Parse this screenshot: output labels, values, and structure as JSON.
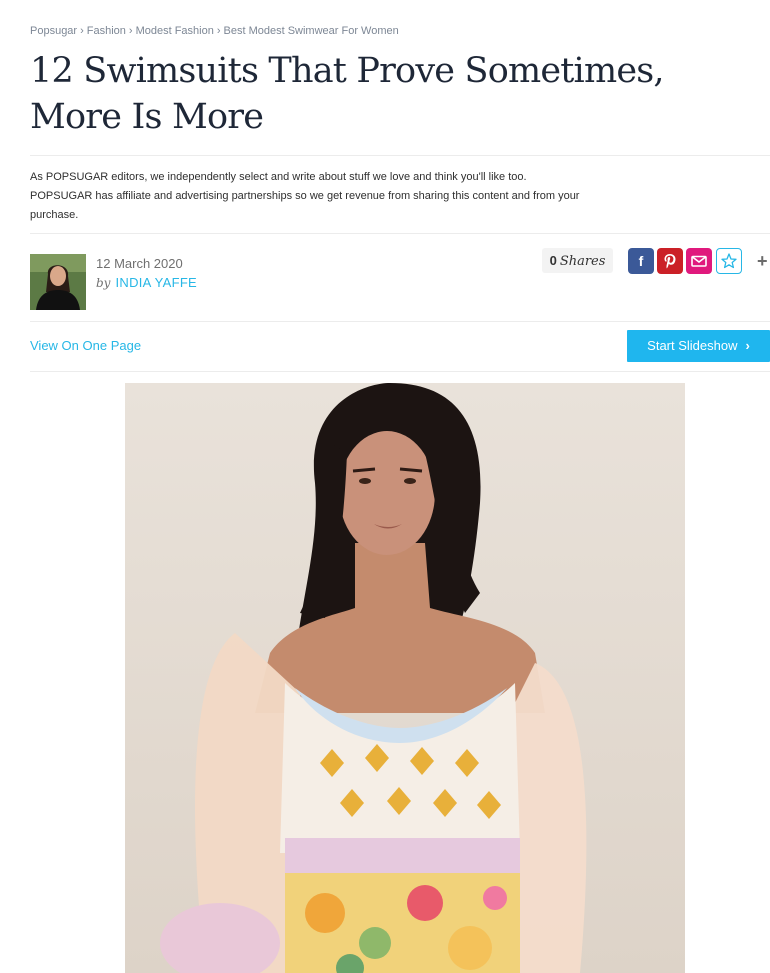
{
  "breadcrumb": {
    "items": [
      "Popsugar",
      "Fashion",
      "Modest Fashion",
      "Best Modest Swimwear For Women"
    ],
    "separator": "›"
  },
  "article": {
    "title": "12 Swimsuits That Prove Sometimes, More Is More",
    "disclaimer": "As POPSUGAR editors, we independently select and write about stuff we love and think you'll like too. POPSUGAR has affiliate and advertising partnerships so we get revenue from sharing this content and from your purchase.",
    "date": "12 March 2020",
    "by_label": "by",
    "author": "INDIA YAFFE"
  },
  "share": {
    "count": "0",
    "label": "Shares",
    "facebook_glyph": "f",
    "more_glyph": "+"
  },
  "actions": {
    "view_one_page": "View On One Page",
    "start_slideshow": "Start Slideshow",
    "chevron": "›"
  },
  "icons": {
    "facebook": "facebook-icon",
    "pinterest": "pinterest-icon",
    "email": "email-icon",
    "save": "star-icon",
    "more": "plus-icon"
  },
  "colors": {
    "accent": "#27b7e6",
    "slideshow_button": "#1fb6ee",
    "facebook": "#3b5998",
    "pinterest": "#cb2027",
    "email": "#e0197d",
    "title": "#1e2737"
  }
}
